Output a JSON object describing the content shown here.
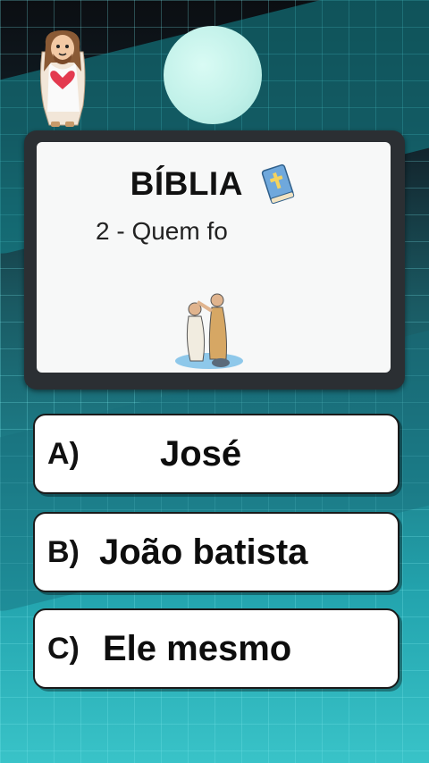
{
  "quiz": {
    "title": "BÍBLIA",
    "question": "2 - Quem fo",
    "options": [
      {
        "letter": "A)",
        "text": "José"
      },
      {
        "letter": "B)",
        "text": "João batista"
      },
      {
        "letter": "C)",
        "text": "Ele mesmo"
      }
    ]
  },
  "icons": {
    "book": "bible-book-icon",
    "jesus": "jesus-figure",
    "baptism": "baptism-illustration"
  }
}
